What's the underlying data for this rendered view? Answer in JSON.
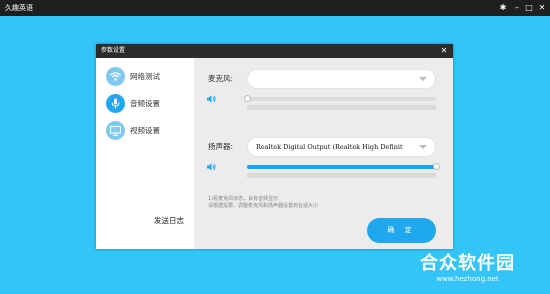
{
  "app": {
    "title": "久趣英语"
  },
  "window_controls": {
    "settings": "✱",
    "minimize": "–",
    "maximize": "□",
    "close": "✕"
  },
  "dialog": {
    "title": "参数设置",
    "close": "✕",
    "sidebar": {
      "items": [
        {
          "label": "网络测试",
          "icon": "wifi-icon",
          "active": false
        },
        {
          "label": "音频设置",
          "icon": "microphone-icon",
          "active": true
        },
        {
          "label": "视频设置",
          "icon": "monitor-icon",
          "active": false
        }
      ],
      "send_log": "发送日志"
    },
    "microphone": {
      "label": "麦克风:",
      "value": "",
      "volume": 0.0
    },
    "speaker": {
      "label": "扬声器:",
      "value": "Realtek Digital Output (Realtek High Definit",
      "volume": 1.0
    },
    "hints": [
      "1)看麦克风状态，会有音频显示",
      "请根据需要，调整麦克风和扬声器设置到合适大小"
    ],
    "ok_button": "确 定"
  },
  "watermark": {
    "text": "合众软件园",
    "url": "www.hezhong.net"
  },
  "colors": {
    "background": "#33c5f8",
    "accent": "#1fa8ee",
    "active_icon": "#1fa8ee",
    "inactive_icon": "#7ec9ee"
  }
}
